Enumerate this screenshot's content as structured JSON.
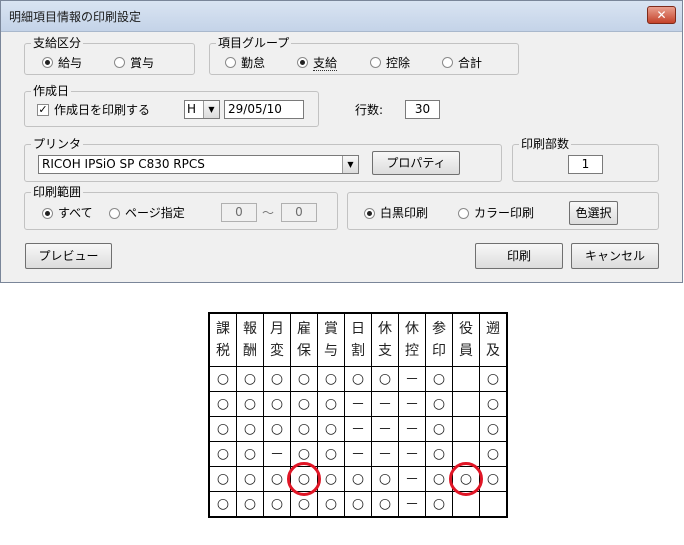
{
  "dialog": {
    "title": "明細項目情報の印刷設定",
    "close_glyph": "✕",
    "pay_type": {
      "label": "支給区分",
      "options": [
        {
          "label": "給与",
          "selected": true
        },
        {
          "label": "賞与",
          "selected": false
        }
      ]
    },
    "item_group": {
      "label": "項目グループ",
      "options": [
        {
          "label": "勤怠",
          "selected": false
        },
        {
          "label": "支給",
          "selected": true
        },
        {
          "label": "控除",
          "selected": false
        },
        {
          "label": "合計",
          "selected": false
        }
      ]
    },
    "created_date": {
      "label": "作成日",
      "print_date_label": "作成日を印刷する",
      "print_date_checked": true,
      "check_glyph": "✓",
      "era_value": "H",
      "date_value": "29/05/10"
    },
    "line_count": {
      "label": "行数:",
      "value": "30"
    },
    "printer": {
      "label": "プリンタ",
      "selected": "RICOH IPSiO SP C830 RPCS",
      "properties_button": "プロパティ"
    },
    "copies": {
      "label": "印刷部数",
      "value": "1"
    },
    "print_range": {
      "label": "印刷範囲",
      "all_label": "すべて",
      "all_selected": true,
      "page_label": "ページ指定",
      "page_from": "0",
      "tilde": "〜",
      "page_to": "0"
    },
    "color_mode": {
      "mono_label": "白黒印刷",
      "mono_selected": true,
      "color_label": "カラー印刷",
      "color_select_button": "色選択"
    },
    "buttons": {
      "preview": "プレビュー",
      "print": "印刷",
      "cancel": "キャンセル"
    },
    "dropdown_glyph": "▼"
  },
  "table": {
    "headers": [
      [
        "課",
        "税"
      ],
      [
        "報",
        "酬"
      ],
      [
        "月",
        "変"
      ],
      [
        "雇",
        "保"
      ],
      [
        "賞",
        "与"
      ],
      [
        "日",
        "割"
      ],
      [
        "休",
        "支"
      ],
      [
        "休",
        "控"
      ],
      [
        "参",
        "印"
      ],
      [
        "役",
        "員"
      ],
      [
        "遡",
        "及"
      ]
    ],
    "rows": [
      [
        "○",
        "○",
        "○",
        "○",
        "○",
        "○",
        "○",
        "－",
        "○",
        "",
        "○"
      ],
      [
        "○",
        "○",
        "○",
        "○",
        "○",
        "－",
        "－",
        "－",
        "○",
        "",
        "○"
      ],
      [
        "○",
        "○",
        "○",
        "○",
        "○",
        "－",
        "－",
        "－",
        "○",
        "",
        "○"
      ],
      [
        "○",
        "○",
        "－",
        "○",
        "○",
        "－",
        "－",
        "－",
        "○",
        "",
        "○"
      ],
      [
        "○",
        "○",
        "○",
        "○",
        "○",
        "○",
        "○",
        "－",
        "○",
        "○",
        "○"
      ],
      [
        "○",
        "○",
        "○",
        "○",
        "○",
        "○",
        "○",
        "－",
        "○",
        "",
        ""
      ]
    ],
    "highlights": [
      {
        "row": 4,
        "column": 3,
        "color": "#e01525"
      },
      {
        "row": 4,
        "column": 9,
        "color": "#e01525"
      }
    ]
  }
}
